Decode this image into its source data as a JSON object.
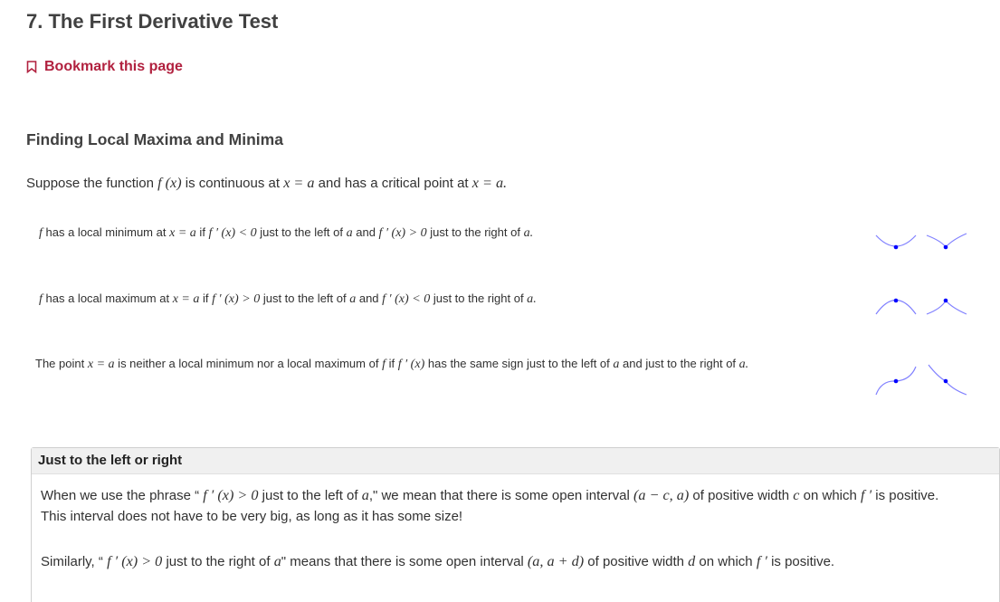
{
  "page_title": "7. The First Derivative Test",
  "bookmark_label": "Bookmark this page",
  "section_heading": "Finding Local Maxima and Minima",
  "intro": [
    {
      "t": "Suppose the function "
    },
    {
      "t": "f (x)",
      "m": 1
    },
    {
      "t": " is continuous at "
    },
    {
      "t": "x = a",
      "m": 1
    },
    {
      "t": " and has a critical point at "
    },
    {
      "t": "x = a.",
      "m": 1
    }
  ],
  "rules": [
    [
      {
        "t": "f",
        "m": 1
      },
      {
        "t": " has a local minimum at "
      },
      {
        "t": "x = a",
        "m": 1
      },
      {
        "t": " if  "
      },
      {
        "t": "f ′ (x) < 0",
        "m": 1
      },
      {
        "t": " just to the left of "
      },
      {
        "t": "a",
        "m": 1
      },
      {
        "t": " and  "
      },
      {
        "t": "f ′ (x) > 0",
        "m": 1
      },
      {
        "t": " just to the right of "
      },
      {
        "t": "a.",
        "m": 1
      }
    ],
    [
      {
        "t": "f",
        "m": 1
      },
      {
        "t": " has a local maximum at "
      },
      {
        "t": "x = a",
        "m": 1
      },
      {
        "t": " if  "
      },
      {
        "t": "f ′ (x) > 0",
        "m": 1
      },
      {
        "t": " just to the left of "
      },
      {
        "t": "a",
        "m": 1
      },
      {
        "t": " and  "
      },
      {
        "t": "f ′ (x) < 0",
        "m": 1
      },
      {
        "t": " just to the right of "
      },
      {
        "t": "a.",
        "m": 1
      }
    ],
    [
      {
        "t": "The point "
      },
      {
        "t": "x = a",
        "m": 1
      },
      {
        "t": " is neither a local minimum nor a local maximum of  "
      },
      {
        "t": "f",
        "m": 1
      },
      {
        "t": " if  "
      },
      {
        "t": "f ′ (x)",
        "m": 1
      },
      {
        "t": " has the same sign just to the left of "
      },
      {
        "t": "a",
        "m": 1
      },
      {
        "t": " and just to the right of "
      },
      {
        "t": "a.",
        "m": 1
      }
    ]
  ],
  "callout": {
    "title": "Just to the left or right",
    "p1": [
      {
        "t": "When we use the phrase “ "
      },
      {
        "t": "f ′ (x) > 0",
        "m": 1
      },
      {
        "t": " just to the left of "
      },
      {
        "t": "a",
        "m": 1
      },
      {
        "t": ",\" we mean that there is some open interval "
      },
      {
        "t": "(a − c, a)",
        "m": 1
      },
      {
        "t": " of positive width "
      },
      {
        "t": "c",
        "m": 1
      },
      {
        "t": " on which  "
      },
      {
        "t": "f ′",
        "m": 1
      },
      {
        "t": "  is positive."
      }
    ],
    "p2": [
      {
        "t": "This interval does not have to be very big, as long as it has some size!"
      }
    ],
    "p3": [
      {
        "t": "Similarly, “ "
      },
      {
        "t": "f ′ (x) > 0",
        "m": 1
      },
      {
        "t": " just to the right of "
      },
      {
        "t": "a",
        "m": 1
      },
      {
        "t": "\" means that there is some open interval "
      },
      {
        "t": "(a, a + d)",
        "m": 1
      },
      {
        "t": " of positive width "
      },
      {
        "t": "d",
        "m": 1
      },
      {
        "t": " on which  "
      },
      {
        "t": "f ′",
        "m": 1
      },
      {
        "t": "  is positive."
      }
    ]
  },
  "colors": {
    "accent": "#b1213f",
    "curve": "#8080ff",
    "point": "#0000ff"
  }
}
